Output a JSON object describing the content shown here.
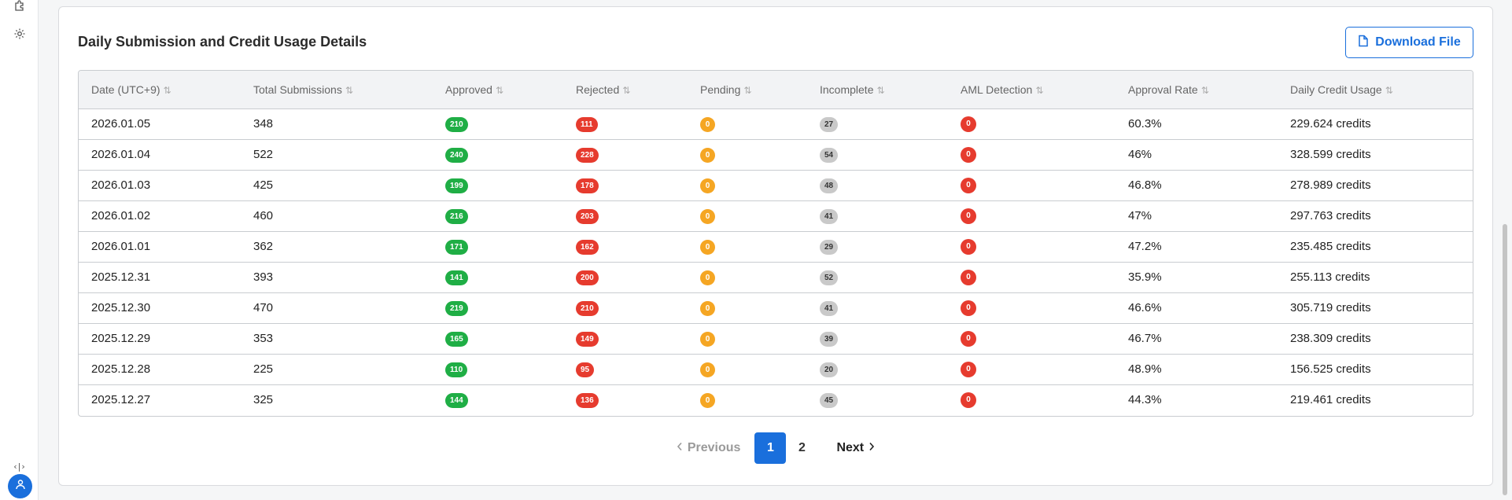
{
  "sidebar": {
    "collapse_glyph": "‹|›"
  },
  "card": {
    "title": "Daily Submission and Credit Usage Details",
    "download_label": "Download File"
  },
  "table": {
    "headers": [
      "Date (UTC+9)",
      "Total Submissions",
      "Approved",
      "Rejected",
      "Pending",
      "Incomplete",
      "AML Detection",
      "Approval Rate",
      "Daily Credit Usage"
    ],
    "rows": [
      {
        "date": "2026.01.05",
        "total": "348",
        "approved": "210",
        "rejected": "111",
        "pending": "0",
        "incomplete": "27",
        "aml": "0",
        "rate": "60.3%",
        "credits": "229.624 credits"
      },
      {
        "date": "2026.01.04",
        "total": "522",
        "approved": "240",
        "rejected": "228",
        "pending": "0",
        "incomplete": "54",
        "aml": "0",
        "rate": "46%",
        "credits": "328.599 credits"
      },
      {
        "date": "2026.01.03",
        "total": "425",
        "approved": "199",
        "rejected": "178",
        "pending": "0",
        "incomplete": "48",
        "aml": "0",
        "rate": "46.8%",
        "credits": "278.989 credits"
      },
      {
        "date": "2026.01.02",
        "total": "460",
        "approved": "216",
        "rejected": "203",
        "pending": "0",
        "incomplete": "41",
        "aml": "0",
        "rate": "47%",
        "credits": "297.763 credits"
      },
      {
        "date": "2026.01.01",
        "total": "362",
        "approved": "171",
        "rejected": "162",
        "pending": "0",
        "incomplete": "29",
        "aml": "0",
        "rate": "47.2%",
        "credits": "235.485 credits"
      },
      {
        "date": "2025.12.31",
        "total": "393",
        "approved": "141",
        "rejected": "200",
        "pending": "0",
        "incomplete": "52",
        "aml": "0",
        "rate": "35.9%",
        "credits": "255.113 credits"
      },
      {
        "date": "2025.12.30",
        "total": "470",
        "approved": "219",
        "rejected": "210",
        "pending": "0",
        "incomplete": "41",
        "aml": "0",
        "rate": "46.6%",
        "credits": "305.719 credits"
      },
      {
        "date": "2025.12.29",
        "total": "353",
        "approved": "165",
        "rejected": "149",
        "pending": "0",
        "incomplete": "39",
        "aml": "0",
        "rate": "46.7%",
        "credits": "238.309 credits"
      },
      {
        "date": "2025.12.28",
        "total": "225",
        "approved": "110",
        "rejected": "95",
        "pending": "0",
        "incomplete": "20",
        "aml": "0",
        "rate": "48.9%",
        "credits": "156.525 credits"
      },
      {
        "date": "2025.12.27",
        "total": "325",
        "approved": "144",
        "rejected": "136",
        "pending": "0",
        "incomplete": "45",
        "aml": "0",
        "rate": "44.3%",
        "credits": "219.461 credits"
      }
    ]
  },
  "pagination": {
    "previous_label": "Previous",
    "pages": [
      "1",
      "2"
    ],
    "current_page": "1",
    "next_label": "Next"
  },
  "icons": {
    "sort": "sort-arrows-icon",
    "download": "file-icon",
    "prev": "chevron-left-icon",
    "next": "chevron-right-icon",
    "plugin": "puzzle-icon",
    "settings": "gear-icon",
    "user": "user-icon"
  },
  "colors": {
    "accent": "#1a6fdc",
    "approved": "#1fae45",
    "rejected": "#e63b2e",
    "pending": "#f5a623",
    "incomplete": "#c9c9c9",
    "aml": "#e63b2e"
  }
}
